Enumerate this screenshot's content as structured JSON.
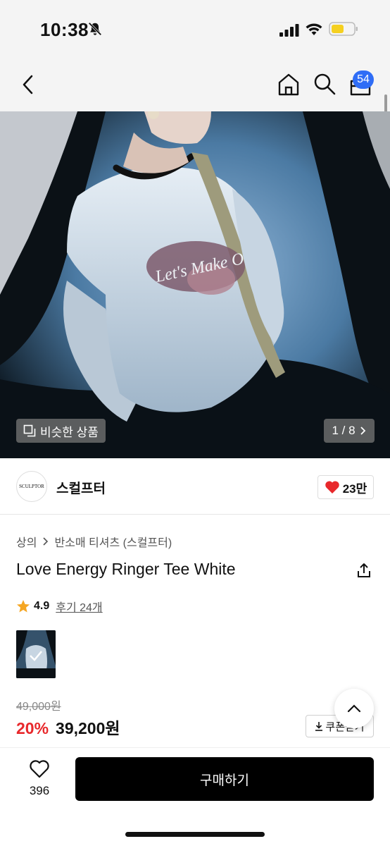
{
  "status_bar": {
    "time": "10:38",
    "battery_color": "#f5d020"
  },
  "nav": {
    "cart_count": "54",
    "accent": "#2f6df6"
  },
  "hero": {
    "similar_label": "비슷한 상품",
    "page_indicator": "1 / 8"
  },
  "brand": {
    "logo_text": "SCULPTOR",
    "name": "스컬프터",
    "likes": "23만"
  },
  "breadcrumb": {
    "category": "상의",
    "subcategory": "반소매 티셔츠 (스컬프터)"
  },
  "product": {
    "title": "Love Energy Ringer Tee White",
    "rating": "4.9",
    "reviews": "후기 24개",
    "original_price": "49,000원",
    "discount": "20%",
    "final_price": "39,200원",
    "coupon_label": "쿠폰받기"
  },
  "bottom": {
    "wish_count": "396",
    "buy_label": "구매하기"
  },
  "colors": {
    "discount": "#e8282b",
    "heart": "#e8282b",
    "star": "#f5a623"
  }
}
